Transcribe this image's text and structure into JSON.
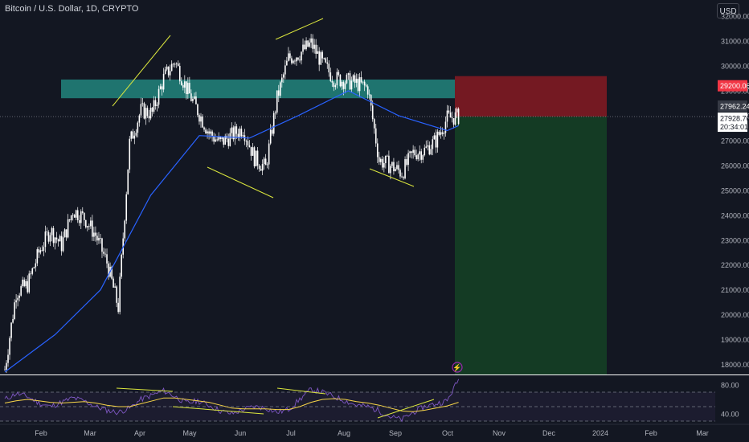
{
  "header": {
    "title": "Bitcoin / U.S. Dollar, 1D, CRYPTO"
  },
  "toolbar": {
    "currency_label": "USD"
  },
  "chart_data": [
    {
      "type": "line",
      "title": "Bitcoin / U.S. Dollar, 1D, CRYPTO",
      "xlabel": "",
      "ylabel": "",
      "ylim": [
        17600,
        32000
      ],
      "y_ticks": [
        18000,
        19000,
        20000,
        21000,
        22000,
        23000,
        24000,
        25000,
        26000,
        27000,
        28000,
        29000,
        30000,
        31000,
        32000
      ],
      "y_tick_labels": [
        "18000.00",
        "19000.00",
        "20000.00",
        "21000.00",
        "22000.00",
        "23000.00",
        "24000.00",
        "25000.00",
        "26000.00",
        "27000.00",
        "28000.00",
        "29000.00",
        "30000.00",
        "31000.00",
        "32000.00"
      ],
      "x_tick_labels": [
        "Feb",
        "Mar",
        "Apr",
        "May",
        "Jun",
        "Jul",
        "Aug",
        "Sep",
        "Oct",
        "Nov",
        "Dec",
        "2024",
        "Feb",
        "Mar"
      ],
      "price_series": {
        "name": "close",
        "x": [
          "Jan 1",
          "Jan 8",
          "Jan 15",
          "Jan 22",
          "Jan 29",
          "Feb 5",
          "Feb 12",
          "Feb 19",
          "Feb 26",
          "Mar 5",
          "Mar 12",
          "Mar 19",
          "Mar 26",
          "Apr 2",
          "Apr 9",
          "Apr 16",
          "Apr 23",
          "Apr 30",
          "May 7",
          "May 14",
          "May 21",
          "May 28",
          "Jun 4",
          "Jun 11",
          "Jun 18",
          "Jun 25",
          "Jul 2",
          "Jul 9",
          "Jul 16",
          "Jul 23",
          "Jul 30",
          "Aug 6",
          "Aug 13",
          "Aug 20",
          "Aug 27",
          "Sep 3",
          "Sep 10",
          "Sep 17",
          "Sep 24",
          "Oct 1",
          "Oct 8"
        ],
        "values": [
          17800,
          20900,
          21200,
          22500,
          23400,
          22800,
          24200,
          23900,
          23200,
          22100,
          20300,
          26900,
          28200,
          28100,
          29500,
          30200,
          29100,
          28200,
          27300,
          26900,
          27200,
          27500,
          26300,
          25900,
          28700,
          30300,
          30500,
          30900,
          30100,
          29500,
          29400,
          29300,
          29100,
          26200,
          26000,
          25700,
          26500,
          26600,
          27000,
          27900,
          27962
        ]
      },
      "moving_average": {
        "name": "MA",
        "x": [
          "Jan 1",
          "Feb 1",
          "Mar 1",
          "Apr 1",
          "May 1",
          "Jun 1",
          "Jul 1",
          "Aug 1",
          "Sep 1",
          "Oct 1",
          "Oct 8"
        ],
        "values": [
          17700,
          19200,
          21000,
          24800,
          27200,
          27100,
          28000,
          29000,
          28000,
          27400,
          27600
        ]
      },
      "resistance_zone": [
        28700,
        29450
      ],
      "trade_box": {
        "entry": 27962.24,
        "stop": 29200.06,
        "target": 17600
      },
      "price_labels": {
        "stop": "29200.06",
        "last": "27962.24",
        "current": "27928.70",
        "countdown": "20:34:01"
      },
      "colors": {
        "background": "#131722",
        "candle": "#ffffff",
        "moving_average": "#2962ff",
        "trendline": "#dbe63d",
        "resistance_zone": "#26a69a",
        "stop_zone": "#801922",
        "target_zone": "#143d25",
        "stop_label": "#f23645",
        "text": "#b2b5be"
      }
    },
    {
      "type": "line",
      "title": "",
      "ylim": [
        30,
        90
      ],
      "y_ticks": [
        40,
        80
      ],
      "y_tick_labels": [
        "40.00",
        "80.00"
      ],
      "bands": [
        70,
        50,
        30
      ],
      "series": [
        {
          "values": [
            60,
            68,
            64,
            55,
            50,
            56,
            62,
            58,
            50,
            45,
            42,
            48,
            60,
            66,
            72,
            64,
            55,
            58,
            52,
            44,
            40,
            46,
            50,
            48,
            42,
            46,
            60,
            74,
            70,
            64,
            58,
            52,
            50,
            44,
            36,
            32,
            42,
            50,
            54,
            58,
            88
          ]
        },
        {
          "values": [
            55,
            58,
            60,
            58,
            56,
            55,
            56,
            57,
            55,
            52,
            50,
            50,
            54,
            58,
            62,
            62,
            60,
            58,
            56,
            52,
            48,
            47,
            47,
            47,
            46,
            46,
            50,
            56,
            60,
            61,
            60,
            57,
            55,
            52,
            48,
            44,
            43,
            45,
            48,
            51,
            56
          ]
        }
      ],
      "colors": {
        "rsi": "#7e57c2",
        "rsi_ma": "#f7d548",
        "band": "#787b86"
      }
    }
  ]
}
